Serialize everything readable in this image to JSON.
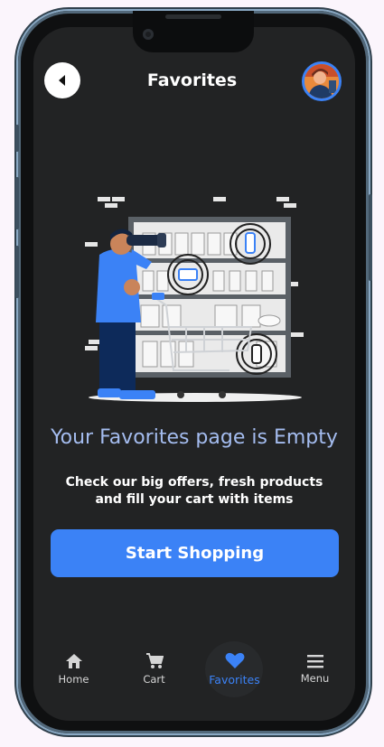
{
  "header": {
    "title": "Favorites",
    "back_icon": "back-arrow-icon",
    "avatar_icon": "user-avatar"
  },
  "empty_state": {
    "heading": "Your Favorites page is Empty",
    "line1": "Check our big offers, fresh products",
    "line2": "and fill your cart with items",
    "button_label": "Start Shopping"
  },
  "nav": {
    "active": "Favorites",
    "items": [
      {
        "label": "Home",
        "icon": "home-icon"
      },
      {
        "label": "Cart",
        "icon": "cart-icon"
      },
      {
        "label": "Favorites",
        "icon": "heart-icon"
      },
      {
        "label": "Menu",
        "icon": "menu-icon"
      }
    ]
  },
  "colors": {
    "accent": "#3b82f6",
    "background": "#222324",
    "heading": "#a4bcef"
  }
}
